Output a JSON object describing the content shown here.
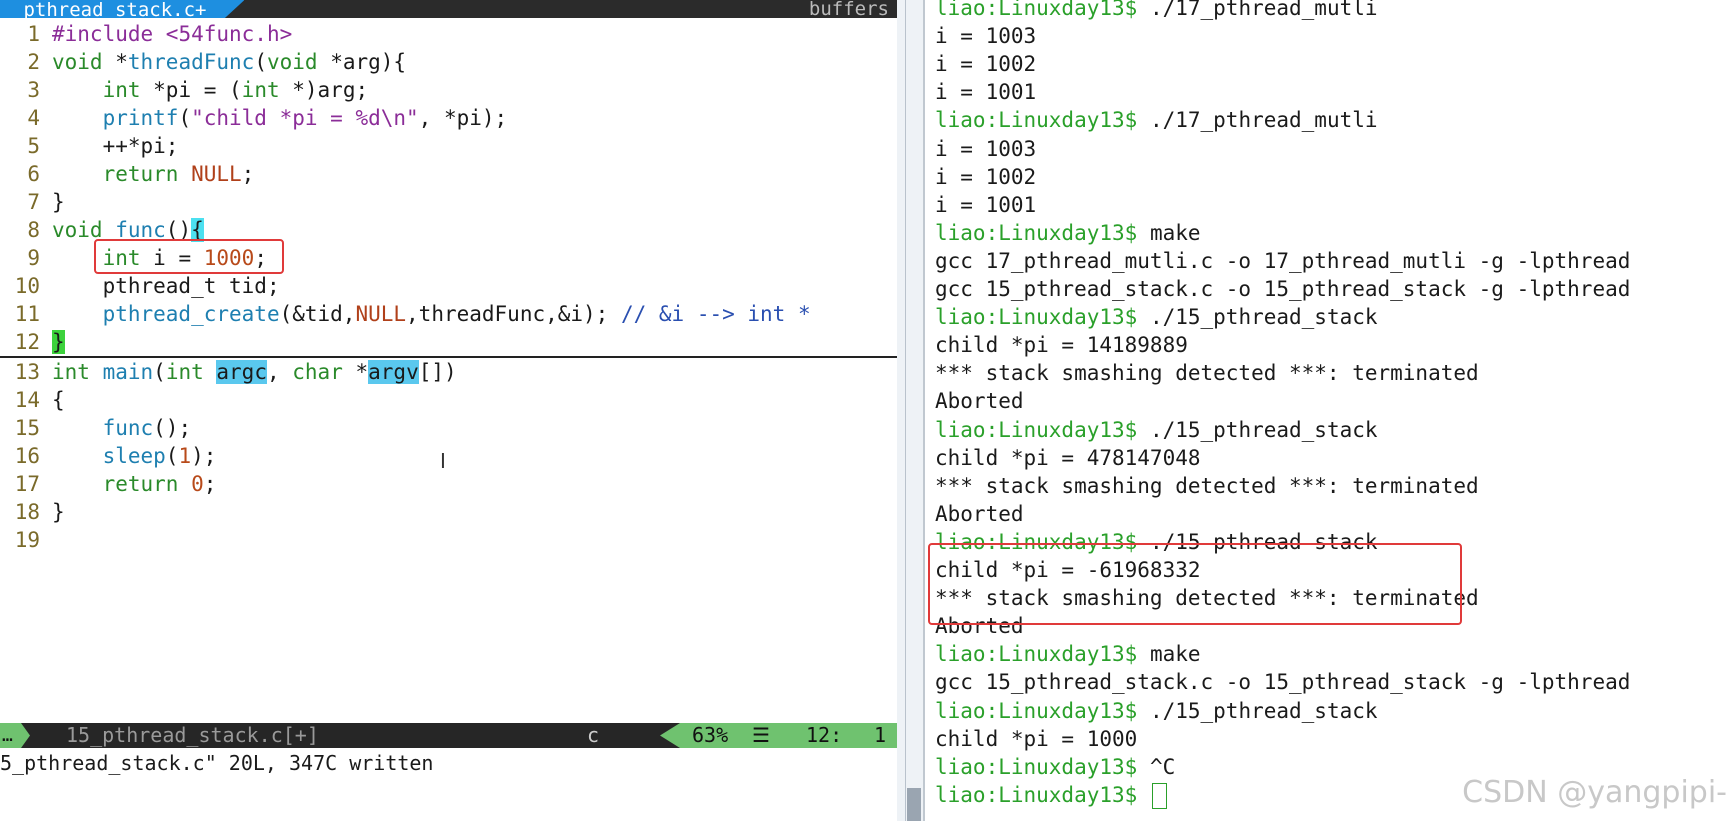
{
  "editor": {
    "tab_active": "_pthread_stack.c+",
    "tab_buffers": "buffers",
    "lines": [
      {
        "n": "1"
      },
      {
        "n": "2"
      },
      {
        "n": "3"
      },
      {
        "n": "4"
      },
      {
        "n": "5"
      },
      {
        "n": "6"
      },
      {
        "n": "7"
      },
      {
        "n": "8"
      },
      {
        "n": "9"
      },
      {
        "n": "10"
      },
      {
        "n": "11"
      },
      {
        "n": "12"
      },
      {
        "n": "13"
      },
      {
        "n": "14"
      },
      {
        "n": "15"
      },
      {
        "n": "16"
      },
      {
        "n": "17"
      },
      {
        "n": "18"
      },
      {
        "n": "19"
      }
    ],
    "t": {
      "l1a": "#include ",
      "l1b": "<54func.h>",
      "l2a": "void ",
      "l2b": "*",
      "l2c": "threadFunc",
      "l2d": "(",
      "l2e": "void ",
      "l2f": "*arg){",
      "l3a": "int ",
      "l3b": "*pi = (",
      "l3c": "int ",
      "l3d": "*)arg;",
      "l4a": "printf",
      "l4b": "(",
      "l4c": "\"child *pi = %d\\n\"",
      "l4d": ", *pi);",
      "l5": "++*pi;",
      "l6a": "return ",
      "l6b": "NULL",
      ";": ";",
      "l7": "}",
      "l8a": "void ",
      "l8b": "func",
      "l8c": "()",
      "l8d": "{",
      "l9a": "int ",
      "l9b": "i = ",
      "l9c": "1000",
      "l10": "pthread_t tid;",
      "l11a": "pthread_create",
      "l11b": "(&tid,",
      "l11c": "NULL",
      "l11d": ",threadFunc,&i); ",
      "l11e": "// &i --> int *",
      "l12": "}",
      "l13a": "int ",
      "l13b": "main",
      "l13c": "(",
      "l13d": "int ",
      "l13e": "argc",
      ", ": ", ",
      "l13f": "char ",
      "l13g": "*",
      "l13h": "argv",
      "l13i": "[])",
      "l14": "{",
      "l15a": "func",
      "l15b": "();",
      "l16a": "sleep",
      "l16b": "(",
      "l16c": "1",
      "l16d": ");",
      "l17a": "return ",
      "l17b": "0",
      "l18": "}"
    },
    "status": {
      "mode": "…",
      "file": "15_pthread_stack.c[+]",
      "filetype": "c",
      "percent": "63%",
      "lines_icon": "☰",
      "line_num": "12:",
      "col_num": "1"
    },
    "cmdline": "5_pthread_stack.c\" 20L, 347C written"
  },
  "terminal": {
    "prompt": "liao:Linuxday13$",
    "lines": [
      {
        "p": "liao:Linuxday13$",
        "c": " ./17_pthread_mutli"
      },
      {
        "p": "",
        "c": "i = 1003"
      },
      {
        "p": "",
        "c": "i = 1002"
      },
      {
        "p": "",
        "c": "i = 1001"
      },
      {
        "p": "liao:Linuxday13$",
        "c": " ./17_pthread_mutli"
      },
      {
        "p": "",
        "c": "i = 1003"
      },
      {
        "p": "",
        "c": "i = 1002"
      },
      {
        "p": "",
        "c": "i = 1001"
      },
      {
        "p": "liao:Linuxday13$",
        "c": " make"
      },
      {
        "p": "",
        "c": "gcc 17_pthread_mutli.c -o 17_pthread_mutli -g -lpthread"
      },
      {
        "p": "",
        "c": "gcc 15_pthread_stack.c -o 15_pthread_stack -g -lpthread"
      },
      {
        "p": "liao:Linuxday13$",
        "c": " ./15_pthread_stack"
      },
      {
        "p": "",
        "c": "child *pi = 14189889"
      },
      {
        "p": "",
        "c": "*** stack smashing detected ***: terminated"
      },
      {
        "p": "",
        "c": "Aborted"
      },
      {
        "p": "liao:Linuxday13$",
        "c": " ./15_pthread_stack"
      },
      {
        "p": "",
        "c": "child *pi = 478147048"
      },
      {
        "p": "",
        "c": "*** stack smashing detected ***: terminated"
      },
      {
        "p": "",
        "c": "Aborted"
      },
      {
        "p": "liao:Linuxday13$",
        "c": " ./15 pthread stack"
      },
      {
        "p": "",
        "c": "child *pi = -61968332"
      },
      {
        "p": "",
        "c": "*** stack smashing detected ***: terminated"
      },
      {
        "p": "",
        "c": "Aborted"
      },
      {
        "p": "liao:Linuxday13$",
        "c": " make"
      },
      {
        "p": "",
        "c": "gcc 15_pthread_stack.c -o 15_pthread_stack -g -lpthread"
      },
      {
        "p": "liao:Linuxday13$",
        "c": " ./15_pthread_stack"
      },
      {
        "p": "",
        "c": "child *pi = 1000"
      },
      {
        "p": "liao:Linuxday13$",
        "c": " ^C"
      },
      {
        "p": "liao:Linuxday13$",
        "c": " "
      }
    ]
  },
  "watermark": "CSDN @yangpipi-",
  "colors": {
    "prompt_green": "#2aa02a",
    "highlight_box_red": "#e03a3a",
    "tab_blue": "#1e8fe0",
    "status_green": "#6fc26f"
  }
}
